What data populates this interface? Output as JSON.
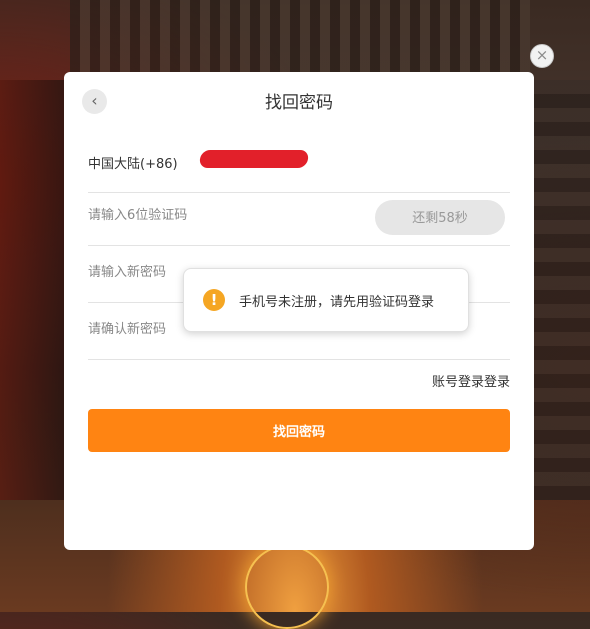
{
  "dialog": {
    "title": "找回密码",
    "phone_region": "中国大陆(+86)",
    "code_placeholder": "请输入6位验证码",
    "code_button": "还剩58秒",
    "new_password_placeholder": "请输入新密码",
    "confirm_password_placeholder": "请确认新密码",
    "account_login_link": "账号登录登录",
    "submit_button": "找回密码"
  },
  "toast": {
    "icon": "!",
    "message": "手机号未注册，请先用验证码登录"
  },
  "icons": {
    "close": "×",
    "back": "‹"
  },
  "colors": {
    "primary": "#ff8412",
    "warning": "#f5a623",
    "redaction": "#e2202a"
  }
}
